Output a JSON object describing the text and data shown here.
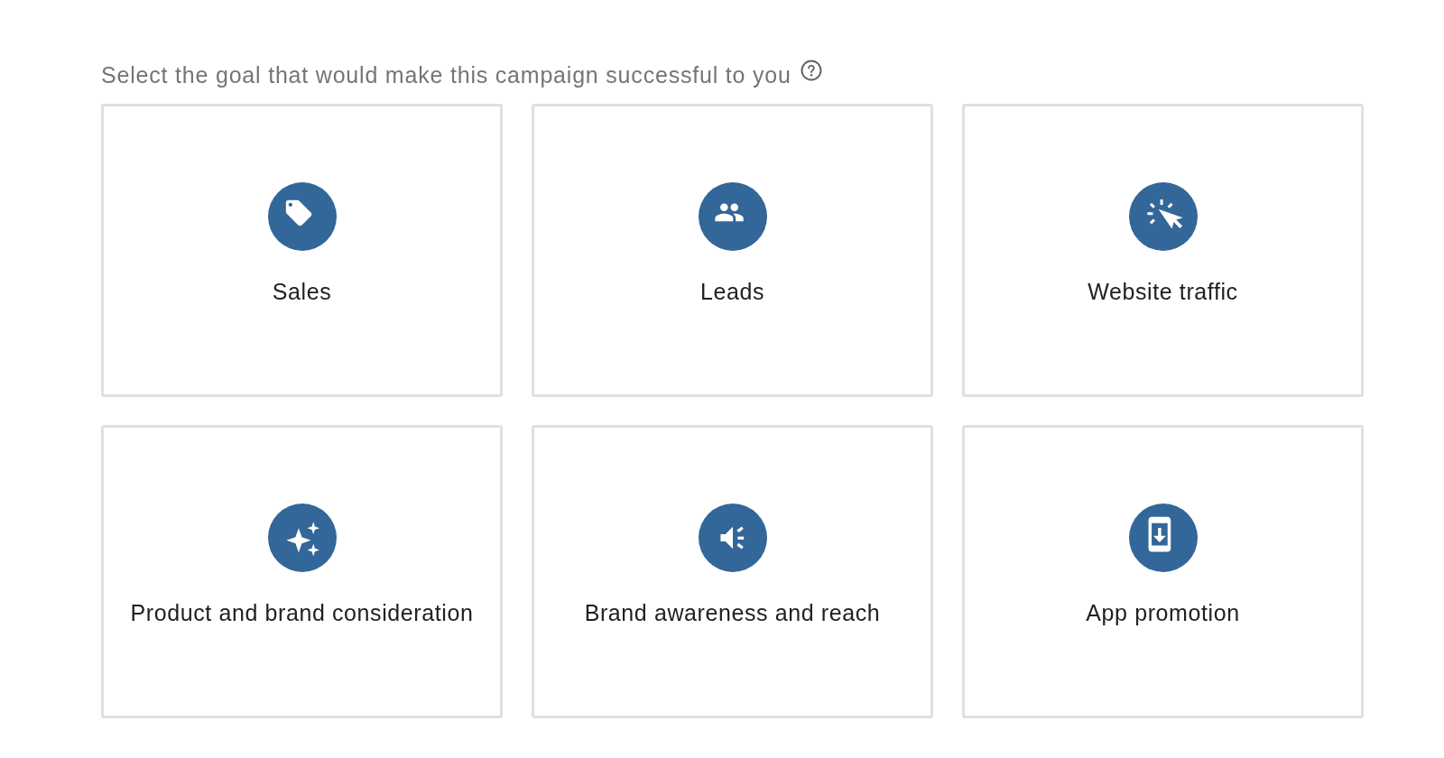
{
  "prompt": {
    "text": "Select the goal that would make this campaign successful to you"
  },
  "goals": [
    {
      "kind": "sales",
      "label": "Sales",
      "selected": false
    },
    {
      "kind": "leads",
      "label": "Leads",
      "selected": false
    },
    {
      "kind": "traffic",
      "label": "Website traffic",
      "selected": false
    },
    {
      "kind": "consideration",
      "label": "Product and brand consideration",
      "selected": false
    },
    {
      "kind": "awareness",
      "label": "Brand awareness and reach",
      "selected": false
    },
    {
      "kind": "app",
      "label": "App promotion",
      "selected": false
    }
  ]
}
